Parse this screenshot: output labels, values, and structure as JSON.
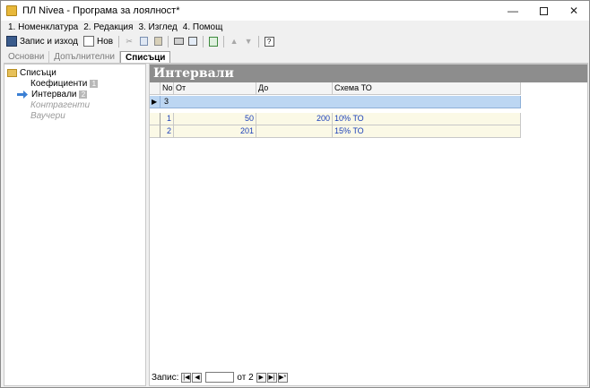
{
  "window": {
    "title": "ПЛ Nivea - Програма за лоялност*"
  },
  "menu": [
    "1. Номенклатура",
    "2. Редакция",
    "3. Изглед",
    "4. Помощ"
  ],
  "toolbar": {
    "save_exit": "Запис и изход",
    "new": "Нов"
  },
  "tabs": [
    {
      "label": "Основни",
      "active": false
    },
    {
      "label": "Допълнителни",
      "active": false
    },
    {
      "label": "Списъци",
      "active": true
    }
  ],
  "tree": {
    "root": "Списъци",
    "items": [
      {
        "label": "Коефициенти",
        "badge": "1",
        "enabled": true,
        "selected": false
      },
      {
        "label": "Интервали",
        "badge": "2",
        "enabled": true,
        "selected": true
      },
      {
        "label": "Контрагенти",
        "badge": "",
        "enabled": false,
        "selected": false
      },
      {
        "label": "Ваучери",
        "badge": "",
        "enabled": false,
        "selected": false
      }
    ]
  },
  "panel": {
    "title": "Интервали"
  },
  "grid": {
    "columns": [
      "No.",
      "От",
      "До",
      "Схема ТО"
    ],
    "filter_value": "3",
    "rows": [
      {
        "no": "1",
        "from": "50",
        "to": "200",
        "scheme": "10% ТО"
      },
      {
        "no": "2",
        "from": "201",
        "to": "",
        "scheme": "15% ТО"
      }
    ]
  },
  "statusbar": {
    "label": "Запис:",
    "of_text": "от 2",
    "current": ""
  },
  "colors": {
    "header_bg": "#8d8d8d",
    "row_bg": "#fbf9e6",
    "filter_bg": "#bcd6f2",
    "data_text": "#1a3fb8"
  }
}
